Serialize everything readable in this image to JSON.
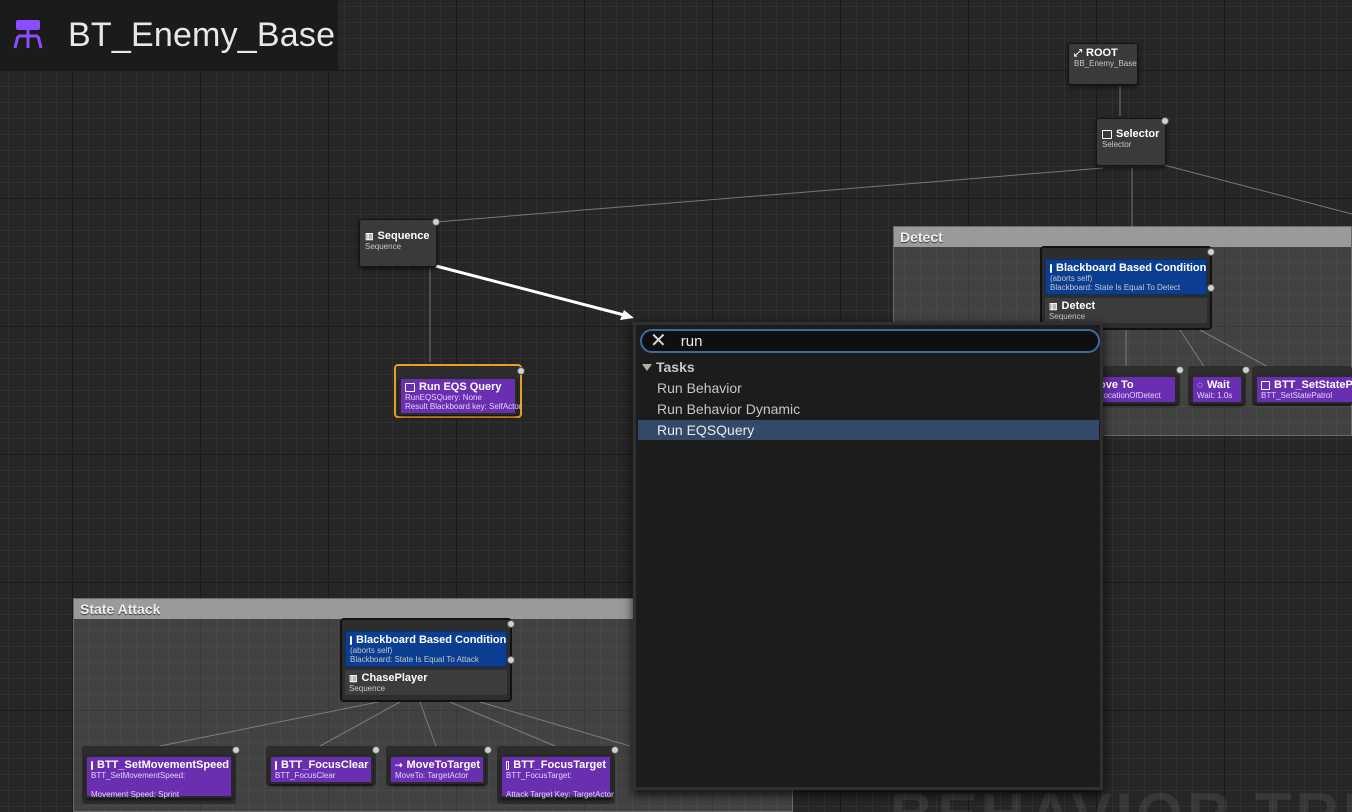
{
  "window": {
    "title": "BT_Enemy_Base"
  },
  "nodes": {
    "root": {
      "title": "ROOT",
      "sub": "BB_Enemy_Base"
    },
    "selector": {
      "title": "Selector",
      "sub": "Selector"
    },
    "sequence": {
      "title": "Sequence",
      "sub": "Sequence"
    },
    "run_eqs": {
      "title": "Run EQS Query",
      "sub1": "RunEQSQuery: None",
      "sub2": "Result Blackboard key: SelfActor"
    }
  },
  "comments": {
    "detect": {
      "label": "Detect",
      "decorator": {
        "title": "Blackboard Based Condition",
        "line1": "(aborts self)",
        "line2": "Blackboard: State Is Equal To Detect"
      },
      "composite": {
        "title": "Detect",
        "sub": "Sequence"
      },
      "tasks": [
        {
          "title": "ove To",
          "sub": "LocationOfDetect"
        },
        {
          "title": "Wait",
          "sub": "Wait: 1.0s"
        },
        {
          "title": "BTT_SetStatePa",
          "sub": "BTT_SetStatePatrol"
        }
      ]
    },
    "attack": {
      "label": "State Attack",
      "decorator": {
        "title": "Blackboard Based Condition",
        "line1": "(aborts self)",
        "line2": "Blackboard: State Is Equal To Attack"
      },
      "composite": {
        "title": "ChasePlayer",
        "sub": "Sequence"
      },
      "tasks": [
        {
          "title": "BTT_SetMovementSpeed",
          "sub": "BTT_SetMovementSpeed:",
          "sub2": "Movement Speed: Sprint"
        },
        {
          "title": "BTT_FocusClear",
          "sub": "BTT_FocusClear"
        },
        {
          "title": "MoveToTarget",
          "sub": "MoveTo: TargetActor"
        },
        {
          "title": "BTT_FocusTarget",
          "sub": "BTT_FocusTarget:",
          "sub2": "Attack Target Key: TargetActor"
        }
      ]
    }
  },
  "menu": {
    "search_value": "run",
    "category": "Tasks",
    "items": [
      "Run Behavior",
      "Run Behavior Dynamic",
      "Run EQSQuery"
    ],
    "selected_index": 2
  },
  "watermark": "BEHAVIOR TREE",
  "colors": {
    "task": "#6a2fb0",
    "decorator": "#0b3d91",
    "selection": "#324a67",
    "title_icon": "#8a4dff"
  }
}
